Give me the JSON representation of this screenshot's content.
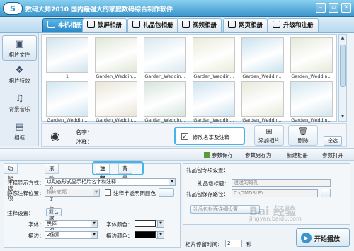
{
  "window": {
    "title": "数码大师2010",
    "slogan": "国内最强大的家庭数码综合制作软件",
    "logo": "S"
  },
  "tabs": [
    {
      "label": "本机相册",
      "active": true
    },
    {
      "label": "锁屏相册",
      "active": false
    },
    {
      "label": "礼品包相册",
      "active": false
    },
    {
      "label": "视频相册",
      "active": false
    },
    {
      "label": "网页相册",
      "active": false
    },
    {
      "label": "升级和注册",
      "active": false
    }
  ],
  "sidebar": {
    "items": [
      {
        "label": "相片文件",
        "icon": "camera-icon",
        "active": true
      },
      {
        "label": "相片特效",
        "icon": "effects-icon",
        "active": false
      },
      {
        "label": "背景音乐",
        "icon": "music-icon",
        "active": false
      },
      {
        "label": "相框",
        "icon": "frame-icon",
        "active": false
      }
    ]
  },
  "grid": {
    "photos": [
      {
        "caption": "1",
        "color": "#cfe3ee"
      },
      {
        "caption": "Garden_Weddin...",
        "color": "#dfe7d6"
      },
      {
        "caption": "Garden_Weddin...",
        "color": "#d8e8f0"
      },
      {
        "caption": "Garden_Weddin...",
        "color": "#e8ecd8"
      },
      {
        "caption": "Garden_Weddin...",
        "color": "#c9e2f0"
      },
      {
        "caption": "Garden_Weddin...",
        "color": "#e4ead8"
      },
      {
        "caption": "Garden_Weddin...",
        "color": "#d0e6f2"
      },
      {
        "caption": "Garden_Weddin...",
        "color": "#e9e4d6"
      },
      {
        "caption": "Garden_Weddin...",
        "color": "#d6e4dc"
      },
      {
        "caption": "Garden_Weddin...",
        "color": "#cde3f1"
      },
      {
        "caption": "Garden_Weddin...",
        "color": "#e6ead9"
      },
      {
        "caption": "Garden_Weddin...",
        "color": "#d2e6ef"
      }
    ]
  },
  "info": {
    "name_label": "名字：",
    "note_label": "注释：",
    "rename_label": "修改名字及注释",
    "rename_checked": true,
    "add_label": "添加相片",
    "delete_label": "删除",
    "select_all_label": "全选"
  },
  "toolbar": {
    "save_params": "参数保存",
    "save_params_as": "参数另存为",
    "new_album": "新建相册",
    "open_params": "参数打开"
  },
  "bottom_tabs": {
    "tab1": "功能选项",
    "tab2": "滚动文字与歌词",
    "tab3": "注释",
    "tab4": "背景"
  },
  "note_panel": {
    "mode_label": "注释显示方式：",
    "mode_value": "以动态形式显示相片名字和注释",
    "static_pos_label": "静态注释位置：",
    "static_pos_value": "相片底部",
    "semi_transparent_label": "注释半透明阴颜色",
    "settings_label": "注释设置：",
    "default_button": "默认",
    "font_label": "字体：",
    "font_value": "黑体",
    "font_color_label": "字体颜色：",
    "stroke_label": "描边：",
    "stroke_value": "2像素",
    "stroke_color_label": "描边颜色："
  },
  "gift_panel": {
    "title": "礼品包专项设置：",
    "gift_title_label": "礼品包标题：",
    "gift_title_value": "漫漫的婚礼",
    "save_path_label": "礼品包保存路径：",
    "save_path_value": "C:\\DMDSLE\\",
    "detail_button": "礼品包封面详细设置"
  },
  "bottom": {
    "stay_time_label": "相片停留时间：",
    "stay_time_value": "2",
    "stay_time_unit": "秒",
    "play_label": "开始播放"
  },
  "watermark": {
    "text": "Bai 经验",
    "url": "jingyan.baidu.com"
  }
}
